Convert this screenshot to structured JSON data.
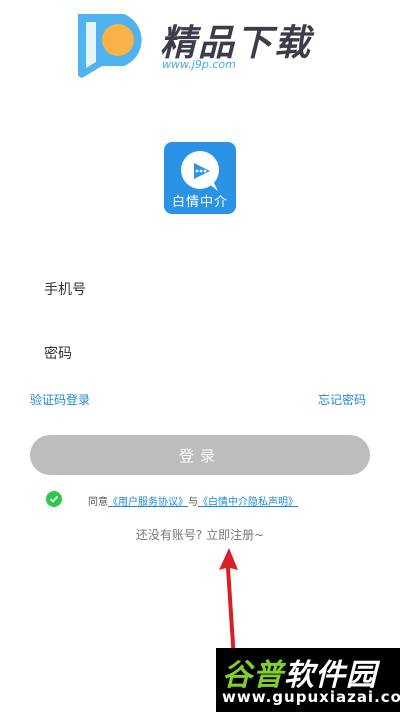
{
  "watermark_top": {
    "title": "精品下载",
    "url": "www.j9p.com"
  },
  "app": {
    "name": "白情中介",
    "icon": "chat-bubble-icon",
    "color": "#2b93e6"
  },
  "form": {
    "phone_placeholder": "手机号",
    "password_placeholder": "密码",
    "code_login": "验证码登录",
    "forgot_password": "忘记密码",
    "login_button": "登录"
  },
  "agreement": {
    "prefix": "同意",
    "terms": "《用户服务协议》",
    "and": "与",
    "privacy": "《白情中介隐私声明》"
  },
  "register": {
    "prompt": "还没有账号?",
    "link": "立即注册~"
  },
  "watermark_bottom": {
    "title_part1": "谷普",
    "title_part2": "软件园",
    "url": "www.gupuxiazai.com"
  },
  "colors": {
    "link": "#1e88d6",
    "button_disabled": "#bdbdbd",
    "check": "#2fc84a",
    "arrow": "#d91f26"
  }
}
